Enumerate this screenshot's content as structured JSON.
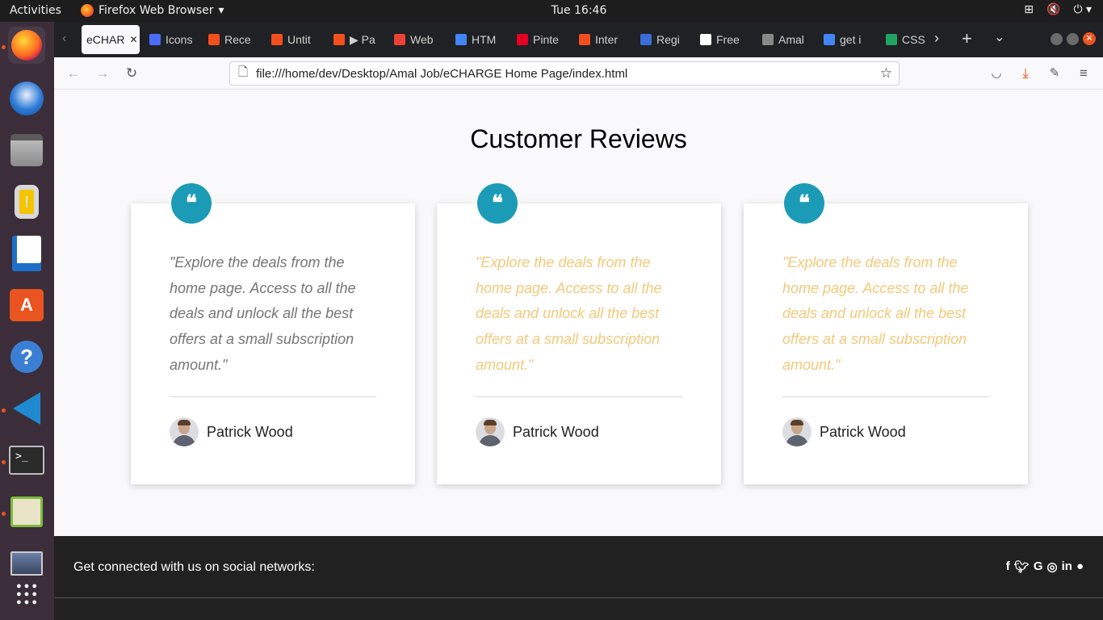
{
  "topbar": {
    "activities": "Activities",
    "app_name": "Firefox Web Browser",
    "clock": "Tue 16:46"
  },
  "tabs": [
    {
      "label": "eCHAR",
      "color": "#e0e0e0"
    },
    {
      "label": "Icons",
      "color": "#4a6cf7"
    },
    {
      "label": "Rece",
      "color": "#f24e1e"
    },
    {
      "label": "Untit",
      "color": "#f24e1e"
    },
    {
      "label": "▶ Pa",
      "color": "#f24e1e"
    },
    {
      "label": "Web",
      "color": "#ea4335"
    },
    {
      "label": "HTM",
      "color": "#4285f4"
    },
    {
      "label": "Pinte",
      "color": "#e60023"
    },
    {
      "label": "Inter",
      "color": "#f24e1e"
    },
    {
      "label": "Regi",
      "color": "#3b6bd6"
    },
    {
      "label": "Free",
      "color": "#ffffff"
    },
    {
      "label": "Amal",
      "color": "#888888"
    },
    {
      "label": "get i",
      "color": "#4285f4"
    },
    {
      "label": "CSS",
      "color": "#1fa463"
    }
  ],
  "url": "file:///home/dev/Desktop/Amal Job/eCHARGE Home Page/index.html",
  "page": {
    "title": "Customer Reviews",
    "reviews": [
      {
        "quote": "\"Explore the deals from the home page. Access to all the deals and unlock all the best offers at a small subscription amount.\"",
        "author": "Patrick Wood",
        "quote_color": "#757575"
      },
      {
        "quote": "\"Explore the deals from the home page. Access to all the deals and unlock all the best offers at a small subscription amount.\"",
        "author": "Patrick Wood",
        "quote_color": "#f3c97a"
      },
      {
        "quote": "\"Explore the deals from the home page. Access to all the deals and unlock all the best offers at a small subscription amount.\"",
        "author": "Patrick Wood",
        "quote_color": "#f3c97a"
      }
    ],
    "quote_mark": "❝",
    "footer_text": "Get connected with us on social networks:",
    "social_icons": [
      "facebook-icon",
      "twitter-icon",
      "google-icon",
      "instagram-icon",
      "linkedin-icon",
      "github-icon"
    ]
  },
  "colors": {
    "accent": "#1c9bb7",
    "footer_bg": "#212121",
    "dock_bg": "#3b2e3a"
  }
}
